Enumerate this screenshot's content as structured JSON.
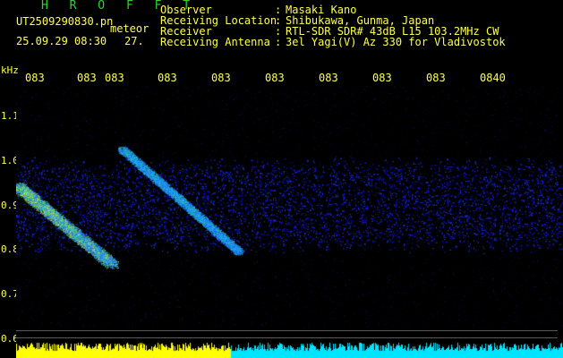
{
  "header": {
    "logo": "H R O F F T",
    "file_name": "UT2509290830.pn",
    "meteor_label": "meteor",
    "datetime": "25.09.29 08:30",
    "count": "27.",
    "info_separator": ":",
    "info": [
      {
        "label": "Observer",
        "value": "Masaki Kano"
      },
      {
        "label": "Receiving Location",
        "value": "Shibukawa, Gunma, Japan"
      },
      {
        "label": "Receiver",
        "value": "RTL-SDR SDR# 43dB L15 103.2MHz CW"
      },
      {
        "label": "Receiving Antenna",
        "value": "3el Yagi(V) Az 330 for Vladivostok"
      }
    ]
  },
  "time_axis": {
    "ticks": [
      "083",
      "083",
      "083",
      "083",
      "083",
      "083",
      "083",
      "083",
      "083",
      "0840"
    ]
  },
  "freq_axis": {
    "unit": "kHz",
    "labels": [
      "1.1",
      "1.0",
      "0.9",
      "0.8",
      "0.7",
      "0.6"
    ]
  },
  "colors": {
    "text": "#ffff55",
    "logo": "#2ed62e",
    "background": "#000000",
    "noise": "#1a33cc",
    "bottom_yellow": "#ffff00",
    "bottom_cyan": "#00e5ff"
  }
}
